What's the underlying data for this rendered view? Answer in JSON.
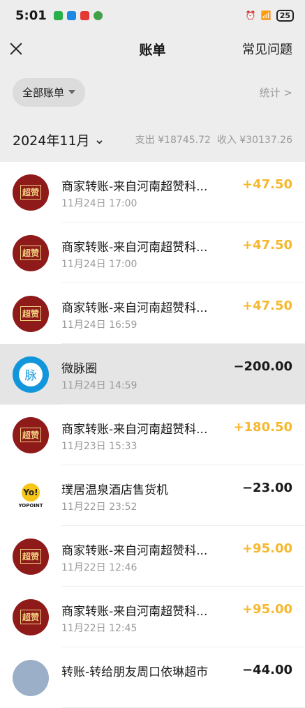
{
  "status_bar": {
    "time": "5:01",
    "battery": "25"
  },
  "nav": {
    "title": "账单",
    "faq": "常见问题"
  },
  "filter": {
    "all_bills": "全部账单",
    "stats": "统计 >"
  },
  "summary": {
    "month": "2024年11月",
    "expense": "支出 ¥18745.72",
    "income": "收入 ¥30137.26"
  },
  "transactions": [
    {
      "name": "商家转账-来自河南超赞科...",
      "date": "11月24日 17:00",
      "amount": "+47.50",
      "avatar": "red"
    },
    {
      "name": "商家转账-来自河南超赞科...",
      "date": "11月24日 17:00",
      "amount": "+47.50",
      "avatar": "red"
    },
    {
      "name": "商家转账-来自河南超赞科...",
      "date": "11月24日 16:59",
      "amount": "+47.50",
      "avatar": "red"
    },
    {
      "name": "微脉圈",
      "date": "11月24日 14:59",
      "amount": "−200.00",
      "avatar": "blue",
      "avatar_text": "脉"
    },
    {
      "name": "商家转账-来自河南超赞科...",
      "date": "11月23日 15:33",
      "amount": "+180.50",
      "avatar": "red"
    },
    {
      "name": "璞居温泉酒店售货机",
      "date": "11月22日 23:52",
      "amount": "−23.00",
      "avatar": "yo",
      "avatar_text": "Yo!",
      "avatar_sub": "YOPOINT"
    },
    {
      "name": "商家转账-来自河南超赞科...",
      "date": "11月22日 12:46",
      "amount": "+95.00",
      "avatar": "red"
    },
    {
      "name": "商家转账-来自河南超赞科...",
      "date": "11月22日 12:45",
      "amount": "+95.00",
      "avatar": "red"
    },
    {
      "name": "转账-转给朋友周口依琳超市",
      "date": "",
      "amount": "−44.00",
      "avatar": "grey"
    }
  ],
  "red_avatar_text": "超赞"
}
